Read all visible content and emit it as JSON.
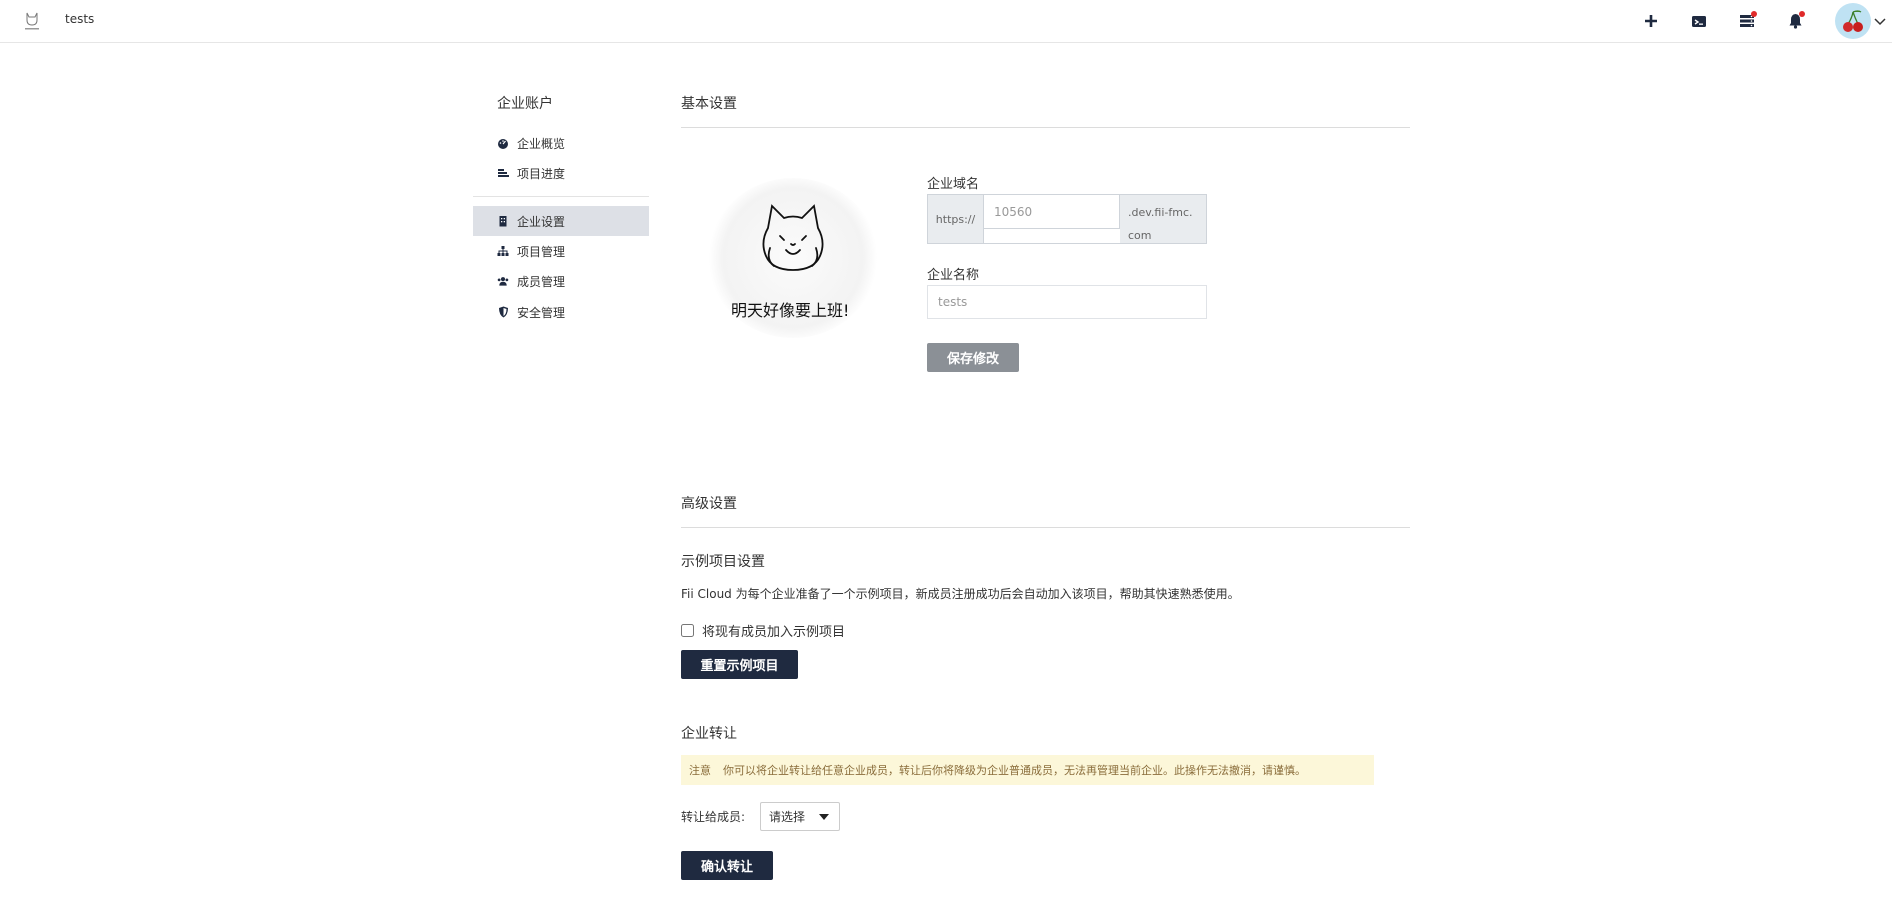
{
  "header": {
    "app_title": "tests",
    "icons": [
      "plus-icon",
      "terminal-folder-icon",
      "server-list-icon",
      "bell-icon"
    ],
    "notification_dot_color": "#e02a2a"
  },
  "sidebar": {
    "title": "企业账户",
    "items": [
      {
        "label": "企业概览",
        "icon": "dashboard-icon"
      },
      {
        "label": "项目进度",
        "icon": "progress-bars-icon"
      },
      {
        "label": "企业设置",
        "icon": "building-icon",
        "active": true
      },
      {
        "label": "项目管理",
        "icon": "sitemap-icon"
      },
      {
        "label": "成员管理",
        "icon": "users-icon"
      },
      {
        "label": "安全管理",
        "icon": "shield-icon"
      }
    ]
  },
  "basic": {
    "title": "基本设置",
    "illustration_caption": "明天好像要上班!",
    "domain_label": "企业域名",
    "domain_prefix": "https://",
    "domain_placeholder": "10560",
    "domain_suffix": ".dev.fii-fmc.com",
    "name_label": "企业名称",
    "name_placeholder": "tests",
    "save_label": "保存修改"
  },
  "advanced": {
    "title": "高级设置",
    "sample_title": "示例项目设置",
    "sample_desc": "Fii Cloud 为每个企业准备了一个示例项目，新成员注册成功后会自动加入该项目，帮助其快速熟悉使用。",
    "checkbox_label": "将现有成员加入示例项目",
    "reset_label": "重置示例项目",
    "transfer_title": "企业转让",
    "warn_label": "注意",
    "warn_text": "你可以将企业转让给任意企业成员，转让后你将降级为企业普通成员，无法再管理当前企业。此操作无法撤消，请谨慎。",
    "transfer_to_label": "转让给成员:",
    "select_value": "请选择",
    "confirm_label": "确认转让"
  },
  "colors": {
    "primary_dark": "#1f2a40",
    "disabled_button": "#8b9096",
    "active_sidebar": "#dde0e6",
    "warning_bg": "#fcf7d9"
  }
}
